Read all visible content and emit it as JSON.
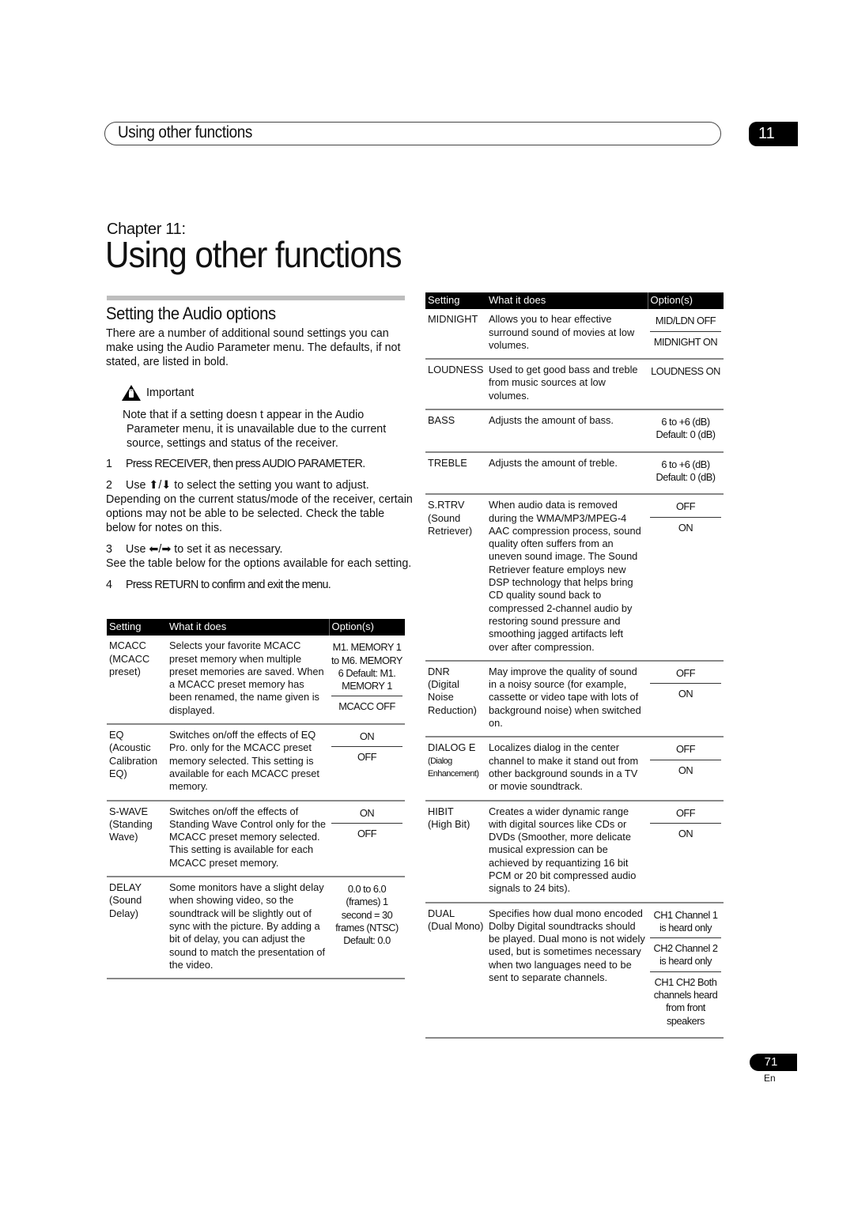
{
  "header": {
    "running_title": "Using other functions",
    "chapter_number": "11"
  },
  "chapter": {
    "label": "Chapter 11:",
    "title": "Using other functions"
  },
  "section": {
    "title": "Setting the Audio options",
    "intro": "There are a number of additional sound settings you can make using the Audio Parameter menu. The defaults, if not stated, are listed in bold.",
    "important_label": "Important",
    "important_icon": "warning-hand-icon",
    "note_line1": "Note that if a setting doesn t appear in the Audio",
    "note_line2": "Parameter menu, it is unavailable due to the current source, settings and status of the receiver."
  },
  "steps": [
    {
      "num": "1",
      "text": "Press RECEIVER, then press  AUDIO PARAMETER."
    },
    {
      "num": "2",
      "text": "Use ⬆/⬇ to select the setting you want to adjust.",
      "detail": "Depending on the current status/mode of the receiver, certain options may not be able to be selected. Check the table below for notes on this."
    },
    {
      "num": "3",
      "text": "Use ⬅/➡ to set it as necessary.",
      "detail": "See the table below for the options available for each setting."
    },
    {
      "num": "4",
      "text": "Press RETURN to confirm and exit the menu."
    }
  ],
  "table_headers": {
    "setting": "Setting",
    "what": "What it does",
    "options": "Option(s)"
  },
  "left_table": [
    {
      "setting": "MCACC",
      "sub": "(MCACC preset)",
      "what": "Selects your favorite MCACC preset memory when multiple preset memories are saved. When a MCACC preset memory has been renamed, the name given is displayed.",
      "options": [
        "M1. MEMORY 1 to M6. MEMORY 6 Default: M1. MEMORY 1",
        "MCACC OFF"
      ]
    },
    {
      "setting": "EQ",
      "sub": "(Acoustic Calibration EQ)",
      "what": "Switches on/off the effects of EQ Pro. only for the MCACC preset memory selected. This setting is available for each MCACC preset memory.",
      "options": [
        "ON",
        "OFF"
      ]
    },
    {
      "setting": "S-WAVE",
      "sub": "(Standing Wave)",
      "what": "Switches on/off the effects of Standing Wave Control only for the MCACC preset memory selected. This setting is available for each MCACC preset memory.",
      "options": [
        "ON",
        "OFF"
      ]
    },
    {
      "setting": "DELAY",
      "sub": "(Sound Delay)",
      "what": "Some monitors have a slight delay when showing video, so the soundtrack will be slightly out of sync with the picture. By adding a bit of delay, you can adjust the sound to match the presentation of the video.",
      "options": [
        "0.0 to 6.0 (frames) 1 second = 30 frames (NTSC) Default: 0.0"
      ]
    }
  ],
  "right_table": [
    {
      "setting": "MIDNIGHT",
      "sub": "",
      "what": "Allows you to hear effective surround sound of movies at low volumes.",
      "options": [
        "MID/LDN OFF",
        "MIDNIGHT ON"
      ]
    },
    {
      "setting": "LOUDNESS",
      "sub": "",
      "what": "Used to get good bass and treble from music sources at low volumes.",
      "options": [
        "LOUDNESS ON"
      ]
    },
    {
      "setting": "BASS",
      "sub": "",
      "what": "Adjusts the amount of bass.",
      "options": [
        "6 to +6 (dB) Default: 0 (dB)"
      ]
    },
    {
      "setting": "TREBLE",
      "sub": "",
      "what": "Adjusts the amount of treble.",
      "options": [
        "6 to +6 (dB) Default: 0 (dB)"
      ]
    },
    {
      "setting": "S.RTRV",
      "sub": "(Sound Retriever)",
      "what": "When audio data is removed during the WMA/MP3/MPEG-4 AAC compression process, sound quality often suffers from an uneven sound image. The Sound Retriever feature employs new DSP technology that helps bring CD quality sound back to compressed 2-channel audio by restoring sound pressure and smoothing jagged artifacts left over after compression.",
      "options": [
        "OFF",
        "ON"
      ]
    },
    {
      "setting": "DNR",
      "sub": "(Digital Noise Reduction)",
      "what": "May improve the quality of sound in a noisy source (for example, cassette or video tape with lots of background noise) when switched on.",
      "options": [
        "OFF",
        "ON"
      ]
    },
    {
      "setting": "DIALOG E",
      "sub": "(Dialog Enhancement)",
      "what": "Localizes dialog in the center channel to make it stand out from other background sounds in a TV or movie soundtrack.",
      "options": [
        "OFF",
        "ON"
      ]
    },
    {
      "setting": "HIBIT",
      "sub": "(High Bit)",
      "what": "Creates a wider dynamic range with digital sources like CDs or DVDs (Smoother, more delicate musical expression can be achieved by requantizing 16 bit PCM or 20 bit compressed audio signals to 24 bits).",
      "options": [
        "OFF",
        "ON"
      ]
    },
    {
      "setting": "DUAL",
      "sub": "(Dual Mono)",
      "what": "Specifies how dual mono encoded Dolby Digital soundtracks should be played. Dual mono is not widely used, but is sometimes necessary when two languages need to be sent to separate channels.",
      "options": [
        "CH1 Channel 1 is heard only",
        "CH2 Channel 2 is heard only",
        "CH1 CH2 Both channels heard from front speakers"
      ]
    }
  ],
  "footer": {
    "page_number": "71",
    "language": "En"
  }
}
